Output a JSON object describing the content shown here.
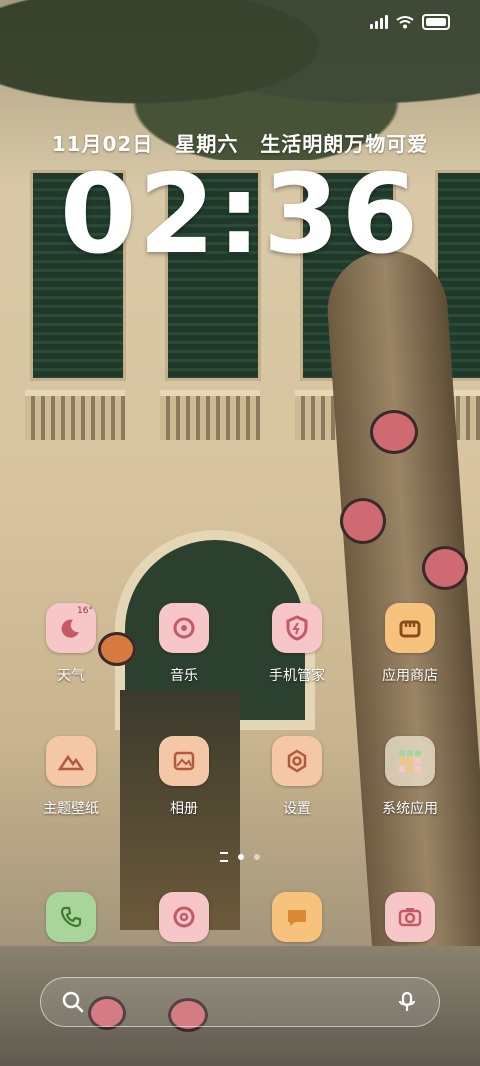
{
  "status_bar": {
    "signal_icon": "signal-icon",
    "wifi_icon": "wifi-icon",
    "battery_icon": "battery-icon"
  },
  "lock": {
    "date": "11月02日",
    "weekday": "星期六",
    "motto": "生活明朗万物可爱",
    "time": "02:36"
  },
  "apps": [
    {
      "label": "天气",
      "icon": "weather-icon",
      "badge": "16°",
      "color": "#f7c6c8"
    },
    {
      "label": "音乐",
      "icon": "music-icon",
      "color": "#f7c6c8"
    },
    {
      "label": "手机管家",
      "icon": "shield-icon",
      "color": "#f7c6c8"
    },
    {
      "label": "应用商店",
      "icon": "store-icon",
      "color": "#f6c27c"
    },
    {
      "label": "主题壁纸",
      "icon": "mountain-icon",
      "color": "#f4c7a6"
    },
    {
      "label": "相册",
      "icon": "gallery-icon",
      "color": "#f4c7a6"
    },
    {
      "label": "设置",
      "icon": "gear-icon",
      "color": "#f4c7a6"
    },
    {
      "label": "系统应用",
      "icon": "folder-icon",
      "color": "#e8dcc8"
    }
  ],
  "dock": [
    {
      "name": "phone",
      "icon": "phone-icon",
      "color": "#a8d69a"
    },
    {
      "name": "browser",
      "icon": "browser-icon",
      "color": "#f7c6c8"
    },
    {
      "name": "messages",
      "icon": "message-icon",
      "color": "#f6c27c"
    },
    {
      "name": "camera",
      "icon": "camera-icon",
      "color": "#f7c6c8"
    }
  ],
  "search": {
    "search_icon": "search-icon",
    "mic_icon": "microphone-icon"
  },
  "page_indicator": {
    "pages": 2,
    "current": 1
  }
}
